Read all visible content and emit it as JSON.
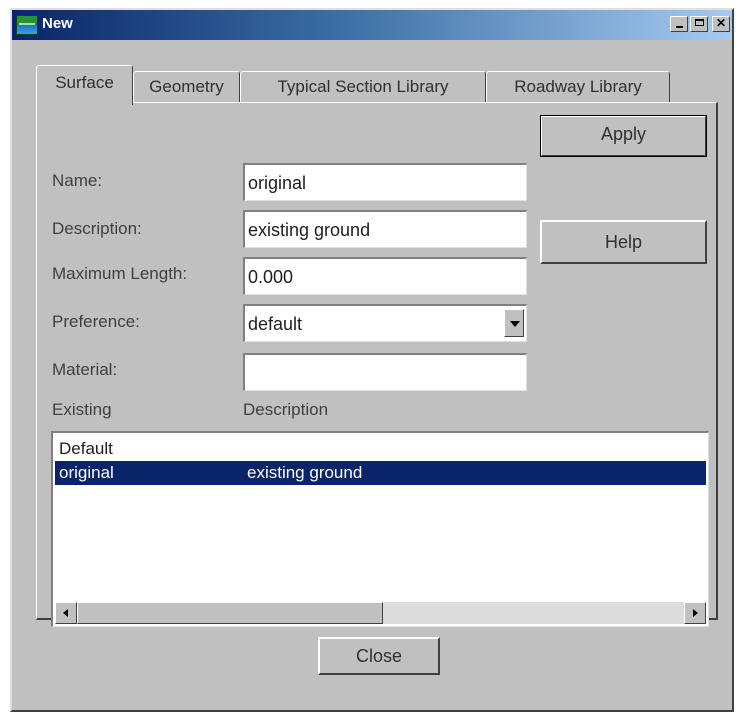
{
  "window": {
    "title": "New"
  },
  "tabs": [
    {
      "label": "Surface",
      "active": true
    },
    {
      "label": "Geometry",
      "active": false
    },
    {
      "label": "Typical Section Library",
      "active": false
    },
    {
      "label": "Roadway Library",
      "active": false
    }
  ],
  "form": {
    "name_label": "Name:",
    "name_value": "original",
    "description_label": "Description:",
    "description_value": "existing ground",
    "max_length_label": "Maximum Length:",
    "max_length_value": "0.000",
    "preference_label": "Preference:",
    "preference_value": "default",
    "material_label": "Material:",
    "material_value": ""
  },
  "buttons": {
    "apply": "Apply",
    "help": "Help",
    "close": "Close"
  },
  "list": {
    "col_existing": "Existing",
    "col_description": "Description",
    "rows": [
      {
        "existing": "Default",
        "description": "",
        "selected": false
      },
      {
        "existing": "original",
        "description": "existing ground",
        "selected": true
      }
    ]
  },
  "colors": {
    "selection": "#0a246a",
    "dialog_face": "#c0c0c0"
  },
  "icons": {
    "app": "app-terrain-icon",
    "minimize": "minimize-icon",
    "maximize": "maximize-icon",
    "close": "close-icon",
    "dropdown": "chevron-down-icon"
  }
}
